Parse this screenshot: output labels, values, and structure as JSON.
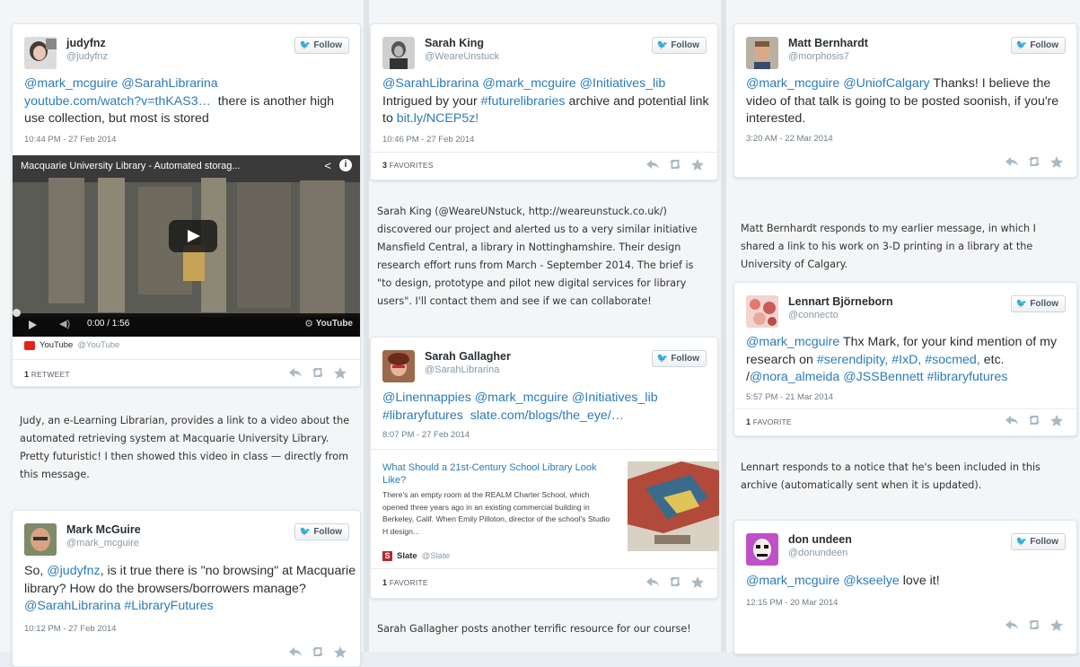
{
  "actions": {
    "reply": "reply-icon",
    "retweet": "retweet-icon",
    "favorite": "star-icon"
  },
  "follow_label": "Follow",
  "tweets": {
    "judy": {
      "name": "judyfnz",
      "handle": "@judyfnz",
      "mentions": "@mark_mcguire @SarahLibrarina",
      "link": "youtube.com/watch?v=thKAS3…",
      "text": "there is another high use collection, but most is stored",
      "time": "10:44 PM - 27 Feb 2014",
      "video": {
        "title": "Macquarie University Library - Automated storag...",
        "time": "0:00 / 1:56",
        "label": "YouTube"
      },
      "source": {
        "name": "YouTube",
        "handle": "@YouTube"
      },
      "stat": {
        "count": "1",
        "label": "RETWEET"
      }
    },
    "sarahking": {
      "name": "Sarah King",
      "handle": "@WeareUnstuck",
      "mentions": "@SarahLibrarina @mark_mcguire @Initiatives_lib",
      "text1": "Intrigued by your",
      "hashtag": "#futurelibraries",
      "text2": "archive and potential link to",
      "link": "bit.ly/NCEP5z!",
      "time": "10:46 PM - 27 Feb 2014",
      "stat": {
        "count": "3",
        "label": "FAVORITES"
      }
    },
    "sarahg": {
      "name": "Sarah Gallagher",
      "handle": "@SarahLibrarina",
      "mentions": "@Linennappies @mark_mcguire @Initiatives_lib",
      "hashtag": "#libraryfutures",
      "link": "slate.com/blogs/the_eye/…",
      "time": "8:07 PM - 27 Feb 2014",
      "article": {
        "title": "What Should a 21st-Century School Library Look Like?",
        "desc": "There's an empty room at the REALM Charter School, which opened three years ago in an existing commercial building in Berkeley, Calif. When Emily Pilloton, director of the school's Studio H design..."
      },
      "source": {
        "name": "Slate",
        "handle": "@Slate"
      },
      "stat": {
        "count": "1",
        "label": "FAVORITE"
      }
    },
    "mark": {
      "name": "Mark McGuire",
      "handle": "@mark_mcguire",
      "text1": "So,",
      "mention1": "@judyfnz",
      "text2": ", is it true there is \"no browsing\" at Macquarie library? How do the browsers/borrowers manage?",
      "mention2": "@SarahLibrarina",
      "hashtag": "#LibraryFutures",
      "time": "10:12 PM - 27 Feb 2014"
    },
    "matt": {
      "name": "Matt Bernhardt",
      "handle": "@morphosis7",
      "mentions": "@mark_mcguire @UniofCalgary",
      "text": "Thanks! I believe the video of that talk is going to be posted soonish, if you're interested.",
      "time": "3:20 AM - 22 Mar 2014"
    },
    "lennart": {
      "name": "Lennart Björneborn",
      "handle": "@connecto",
      "mention": "@mark_mcguire",
      "text1": "Thx Mark, for your kind mention of my research on",
      "tags": "#serendipity, #IxD, #socmed,",
      "text2": "etc.",
      "slash": "/",
      "mentions2": "@nora_almeida @JSSBennett",
      "hashtag": "#libraryfutures",
      "time": "5:57 PM - 21 Mar 2014",
      "stat": {
        "count": "1",
        "label": "FAVORITE"
      }
    },
    "don": {
      "name": "don undeen",
      "handle": "@donundeen",
      "mentions": "@mark_mcguire @kseelye",
      "text": "love it!",
      "time": "12:15 PM - 20 Mar 2014"
    }
  },
  "notes": {
    "judy": "Judy, an e-Learning Librarian, provides a link to a video about the automated retrieving system at Macquarie University Library. Pretty futuristic! I then showed this video in class — directly from this message.",
    "sarahking": "Sarah King (@WeareUNstuck, http://weareunstuck.co.uk/) discovered our project and alerted us to a very similar initiative Mansfield Central, a library in Nottinghamshire. Their design research effort runs from March - September 2014. The brief is \"to design, prototype and pilot new digital services for library users\". I'll contact them and see if we can collaborate!",
    "sarahg": "Sarah Gallagher posts another terrific resource for our course!",
    "matt": "Matt Bernhardt responds to my earlier message, in which I shared a link to his work on 3-D printing in a library at the University of Calgary.",
    "lennart": "Lennart responds to a notice that he's been included in this archive (automatically sent when it is updated)."
  },
  "colors": {
    "link": "#2b7bb9",
    "follow_bird": "#55acee",
    "youtube_red": "#e62117",
    "slate_red": "#b7282e"
  }
}
